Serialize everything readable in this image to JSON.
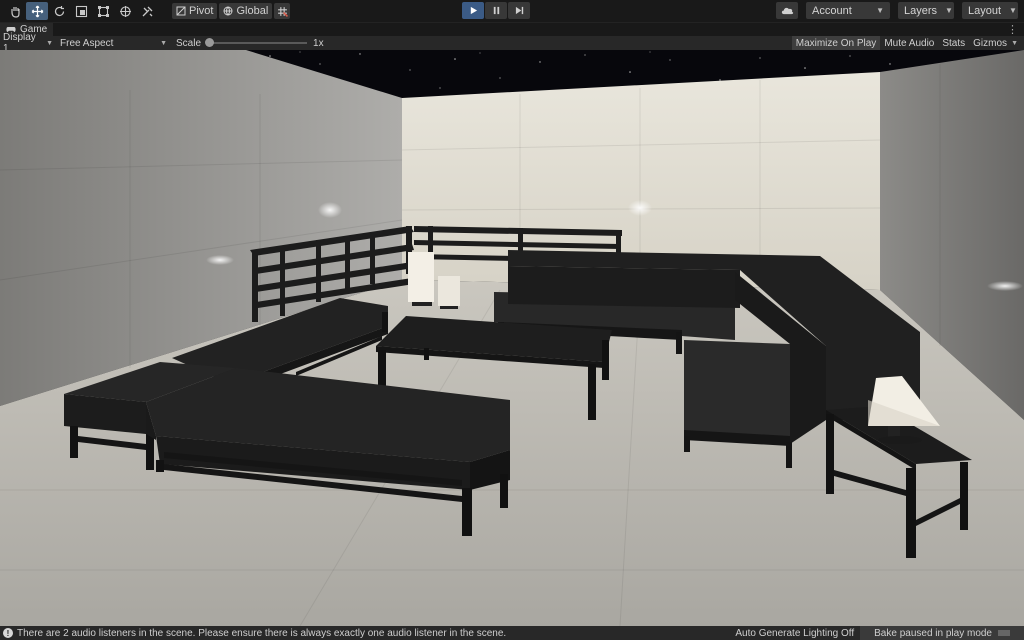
{
  "toolbar": {
    "tools": [
      {
        "name": "hand-tool-icon",
        "active": false
      },
      {
        "name": "move-tool-icon",
        "active": true
      },
      {
        "name": "rotate-tool-icon",
        "active": false
      },
      {
        "name": "scale-tool-icon",
        "active": false
      },
      {
        "name": "rect-tool-icon",
        "active": false
      },
      {
        "name": "transform-tool-icon",
        "active": false
      },
      {
        "name": "custom-tool-icon",
        "active": false
      }
    ],
    "pivot_label": "Pivot",
    "global_label": "Global",
    "account_label": "Account",
    "layers_label": "Layers",
    "layout_label": "Layout",
    "play_state": "playing"
  },
  "tab": {
    "title": "Game",
    "menu_icon": "kebab-menu-icon"
  },
  "game_toolbar": {
    "display": "Display 1",
    "aspect": "Free Aspect",
    "scale_label": "Scale",
    "scale_value": "1x",
    "maximize_on_play": "Maximize On Play",
    "mute_audio": "Mute Audio",
    "stats": "Stats",
    "gizmos": "Gizmos"
  },
  "status": {
    "message": "There are 2 audio listeners in the scene. Please ensure there is always exactly one audio listener in the scene.",
    "lighting": "Auto Generate Lighting Off",
    "bake": "Bake paused in play mode"
  },
  "colors": {
    "accent": "#3b5b86",
    "panel": "#282828",
    "toolbar": "#191919"
  }
}
